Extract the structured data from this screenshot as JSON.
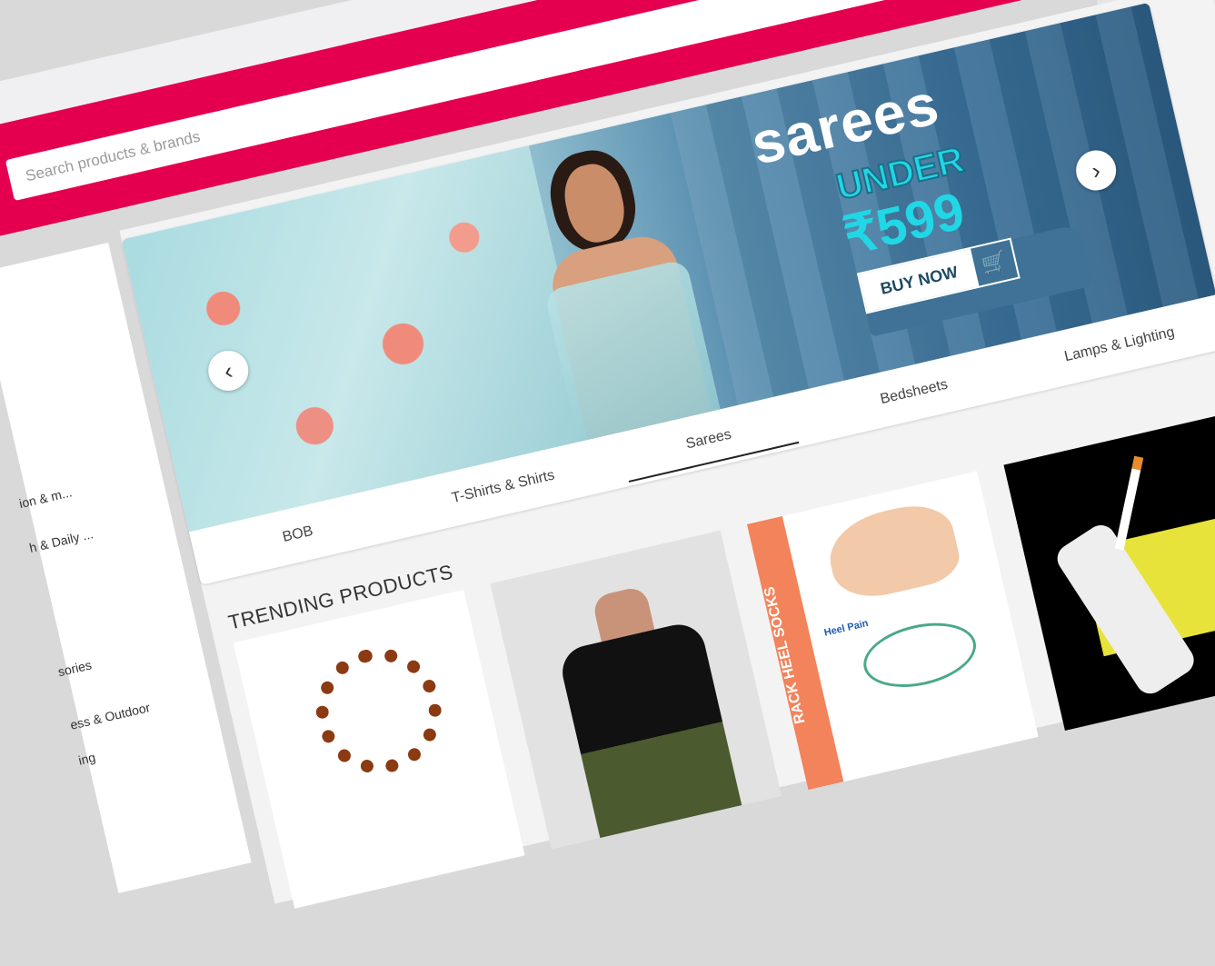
{
  "browser": {
    "url_fragment": "b"
  },
  "header": {
    "search_placeholder": "Search products & brands"
  },
  "sidebar": {
    "items": [
      {
        "label": "ion & m..."
      },
      {
        "label": "h & Daily ..."
      },
      {
        "label": "sories"
      },
      {
        "label": "ess & Outdoor"
      },
      {
        "label": "ing"
      }
    ]
  },
  "banner": {
    "title": "sarees",
    "under": "UNDER",
    "price": "₹599",
    "cta": "BUY NOW",
    "prev_icon": "chevron-left-icon",
    "next_icon": "chevron-right-icon"
  },
  "category_tabs": [
    {
      "label": "BOB",
      "active": false
    },
    {
      "label": "T-Shirts & Shirts",
      "active": false
    },
    {
      "label": "Sarees",
      "active": true
    },
    {
      "label": "Bedsheets",
      "active": false
    },
    {
      "label": "Lamps & Lighting",
      "active": false
    }
  ],
  "trending": {
    "heading": "TRENDING PRODUCTS",
    "products": [
      {
        "name": "rudraksha-mala"
      },
      {
        "name": "v-neck-tshirt"
      },
      {
        "name": "crack-heel-socks",
        "strip_text": "RACK HEEL SOCKS",
        "tag_text": "Heel Pain"
      },
      {
        "name": "usb-lighter"
      },
      {
        "name": "partial-product"
      }
    ]
  },
  "colors": {
    "brand": "#e4004f",
    "accent_text": "#20d7e6"
  }
}
